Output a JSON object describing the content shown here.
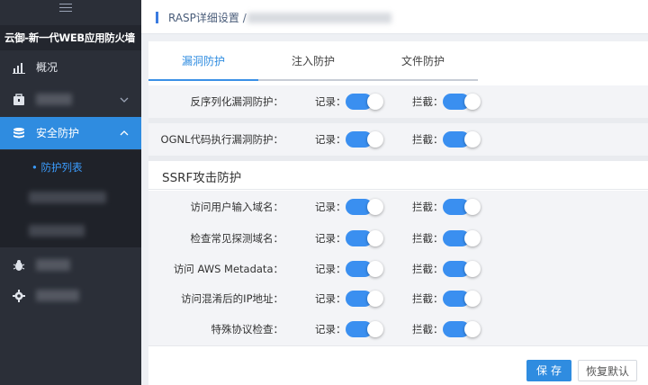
{
  "sidebar": {
    "brand": "云御-新一代WEB应用防火墙",
    "overview_label": "概况",
    "security_label": "安全防护",
    "sub_protection_list": "• 防护列表"
  },
  "breadcrumb": {
    "current": "RASP详细设置 /"
  },
  "tabs": [
    {
      "label": "漏洞防护",
      "active": true
    },
    {
      "label": "注入防护",
      "active": false
    },
    {
      "label": "文件防护",
      "active": false
    }
  ],
  "labels": {
    "record": "记录：",
    "block": "拦截："
  },
  "rows": [
    {
      "label": "反序列化漏洞防护：",
      "record_on": true,
      "block_on": true
    },
    {
      "label": "OGNL代码执行漏洞防护：",
      "record_on": true,
      "block_on": true
    }
  ],
  "ssrf": {
    "title": "SSRF攻击防护",
    "rows": [
      {
        "label": "访问用户输入域名：",
        "record_on": true,
        "block_on": true
      },
      {
        "label": "检查常见探测域名：",
        "record_on": true,
        "block_on": true
      },
      {
        "label": "访问 AWS Metadata：",
        "record_on": true,
        "block_on": true
      },
      {
        "label": "访问混淆后的IP地址：",
        "record_on": true,
        "block_on": true
      },
      {
        "label": "特殊协议检查：",
        "record_on": true,
        "block_on": true
      }
    ]
  },
  "buttons": {
    "save": "保存",
    "reset": "恢复默认"
  },
  "colors": {
    "accent": "#2f8ce0",
    "sidebar_bg": "#2b2f38",
    "toggle_on": "#3a8ff0"
  }
}
